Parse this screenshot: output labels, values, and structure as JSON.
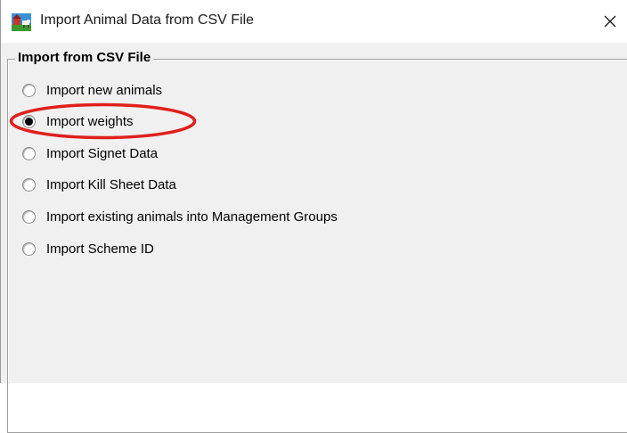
{
  "window": {
    "title": "Import Animal Data from CSV File",
    "close_glyph": "✕",
    "app_icon": "farm-app-icon"
  },
  "group": {
    "legend": "Import from CSV File",
    "options": [
      {
        "label": "Import new animals",
        "checked": false
      },
      {
        "label": "Import weights",
        "checked": true
      },
      {
        "label": "Import Signet Data",
        "checked": false
      },
      {
        "label": "Import Kill Sheet Data",
        "checked": false
      },
      {
        "label": "Import existing animals into Management Groups",
        "checked": false
      },
      {
        "label": "Import Scheme ID",
        "checked": false
      }
    ]
  },
  "annotation": {
    "type": "ellipse-highlight",
    "target": "Import weights",
    "color": "#e0201c"
  }
}
